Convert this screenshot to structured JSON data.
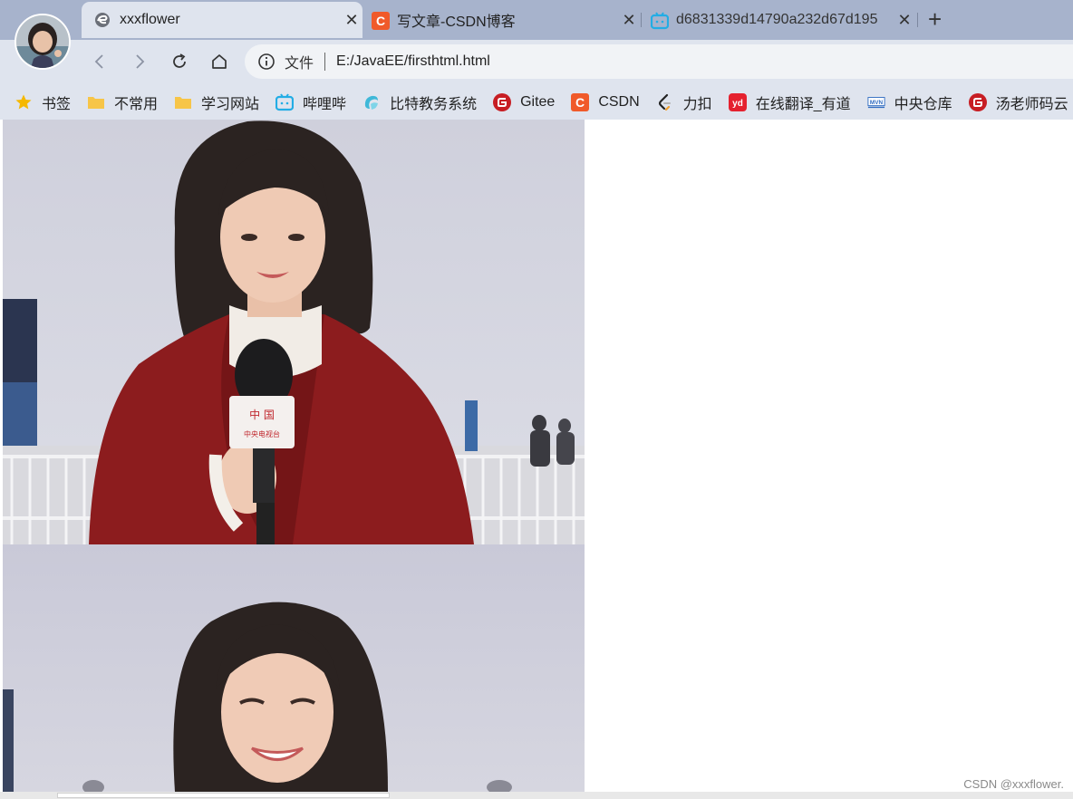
{
  "tabs": [
    {
      "title": "xxxflower",
      "active": true,
      "icon": "edge-logo-icon"
    },
    {
      "title": "写文章-CSDN博客",
      "active": false,
      "icon": "csdn-icon"
    },
    {
      "title": "d6831339d14790a232d67d195",
      "active": false,
      "icon": "bilibili-icon"
    }
  ],
  "navbar": {
    "scheme_label": "文件",
    "url": "E:/JavaEE/firsthtml.html"
  },
  "bookmarks": [
    {
      "label": "书签",
      "icon": "star-icon"
    },
    {
      "label": "不常用",
      "icon": "folder-icon"
    },
    {
      "label": "学习网站",
      "icon": "folder-icon"
    },
    {
      "label": "哔哩哔",
      "icon": "bilibili-icon"
    },
    {
      "label": "比特教务系统",
      "icon": "bit-icon"
    },
    {
      "label": "Gitee",
      "icon": "gitee-icon"
    },
    {
      "label": "CSDN",
      "icon": "csdn-icon"
    },
    {
      "label": "力扣",
      "icon": "leetcode-icon"
    },
    {
      "label": "在线翻译_有道",
      "icon": "youdao-icon"
    },
    {
      "label": "中央仓库",
      "icon": "maven-icon"
    },
    {
      "label": "汤老师码云",
      "icon": "gitee-icon"
    }
  ],
  "content": {
    "mic_label_line1": "中 国",
    "mic_label_line2": "中央电视台"
  },
  "watermark": "CSDN @xxxflower.",
  "colors": {
    "tabstrip": "#a7b3cc",
    "toolbar": "#dfe4ee",
    "csdn": "#f05a2a",
    "gitee": "#c71d23",
    "bilibili": "#23ade5"
  }
}
